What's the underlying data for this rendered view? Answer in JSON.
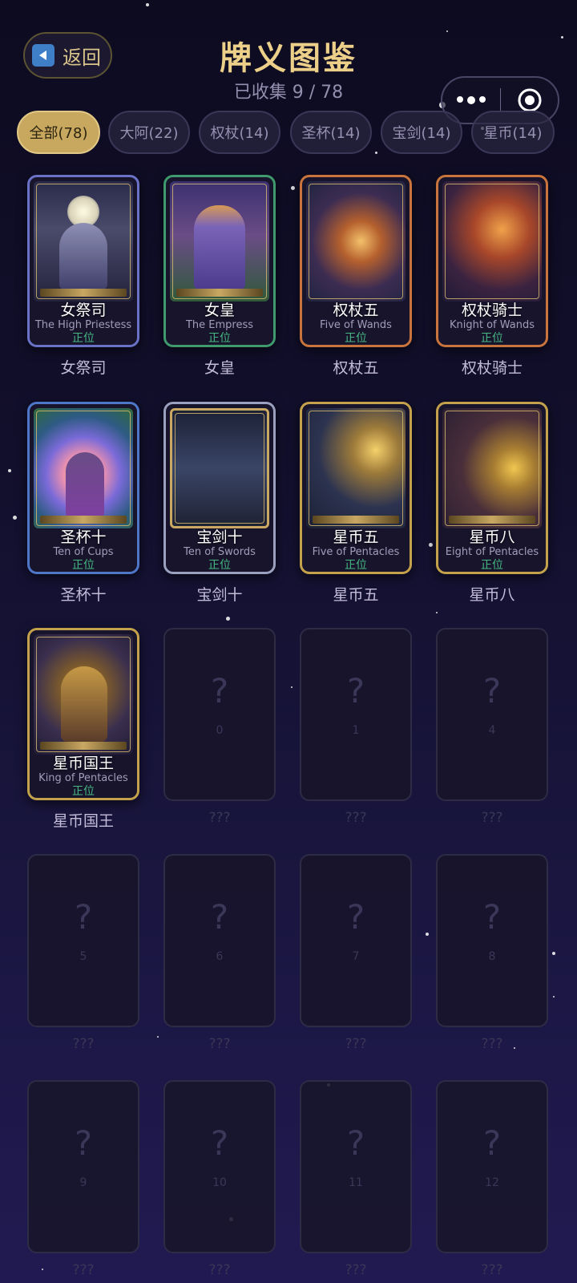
{
  "header": {
    "back_label": "返回",
    "title": "牌义图鉴",
    "collected": "已收集 9 / 78"
  },
  "icons": {
    "back": "back-triangle-icon",
    "more": "more-dots-icon",
    "close": "target-circle-icon"
  },
  "tabs": [
    {
      "label": "全部(78)",
      "active": true
    },
    {
      "label": "大阿(22)",
      "active": false
    },
    {
      "label": "权杖(14)",
      "active": false
    },
    {
      "label": "圣杯(14)",
      "active": false
    },
    {
      "label": "宝剑(14)",
      "active": false
    },
    {
      "label": "星币(14)",
      "active": false
    }
  ],
  "colors": {
    "accent_gold": "#c8a85f",
    "title_gold": "#ecd08a",
    "upright_green": "#46b982"
  },
  "cards": [
    {
      "cn": "女祭司",
      "en": "The High Priestess",
      "orientation": "正位",
      "caption": "女祭司",
      "border": "#6a72c8"
    },
    {
      "cn": "女皇",
      "en": "The Empress",
      "orientation": "正位",
      "caption": "女皇",
      "border": "#3f9a6d"
    },
    {
      "cn": "权杖五",
      "en": "Five of Wands",
      "orientation": "正位",
      "caption": "权杖五",
      "border": "#c8743c"
    },
    {
      "cn": "权杖骑士",
      "en": "Knight of Wands",
      "orientation": "正位",
      "caption": "权杖骑士",
      "border": "#c8743c"
    },
    {
      "cn": "圣杯十",
      "en": "Ten of Cups",
      "orientation": "正位",
      "caption": "圣杯十",
      "border": "#4f77c8"
    },
    {
      "cn": "宝剑十",
      "en": "Ten of Swords",
      "orientation": "正位",
      "caption": "宝剑十",
      "border": "#9aa0bd"
    },
    {
      "cn": "星币五",
      "en": "Five of Pentacles",
      "orientation": "正位",
      "caption": "星币五",
      "border": "#c4a24c"
    },
    {
      "cn": "星币八",
      "en": "Eight of Pentacles",
      "orientation": "正位",
      "caption": "星币八",
      "border": "#c4a24c"
    },
    {
      "cn": "星币国王",
      "en": "King of Pentacles",
      "orientation": "正位",
      "caption": "星币国王",
      "border": "#c4a24c"
    }
  ],
  "locked": [
    {
      "q": "?",
      "num": "0",
      "caption": "???"
    },
    {
      "q": "?",
      "num": "1",
      "caption": "???"
    },
    {
      "q": "?",
      "num": "4",
      "caption": "???"
    },
    {
      "q": "?",
      "num": "5",
      "caption": "???"
    },
    {
      "q": "?",
      "num": "6",
      "caption": "???"
    },
    {
      "q": "?",
      "num": "7",
      "caption": "???"
    },
    {
      "q": "?",
      "num": "8",
      "caption": "???"
    },
    {
      "q": "?",
      "num": "9",
      "caption": "???"
    },
    {
      "q": "?",
      "num": "10",
      "caption": "???"
    },
    {
      "q": "?",
      "num": "11",
      "caption": "???"
    },
    {
      "q": "?",
      "num": "12",
      "caption": "???"
    }
  ]
}
